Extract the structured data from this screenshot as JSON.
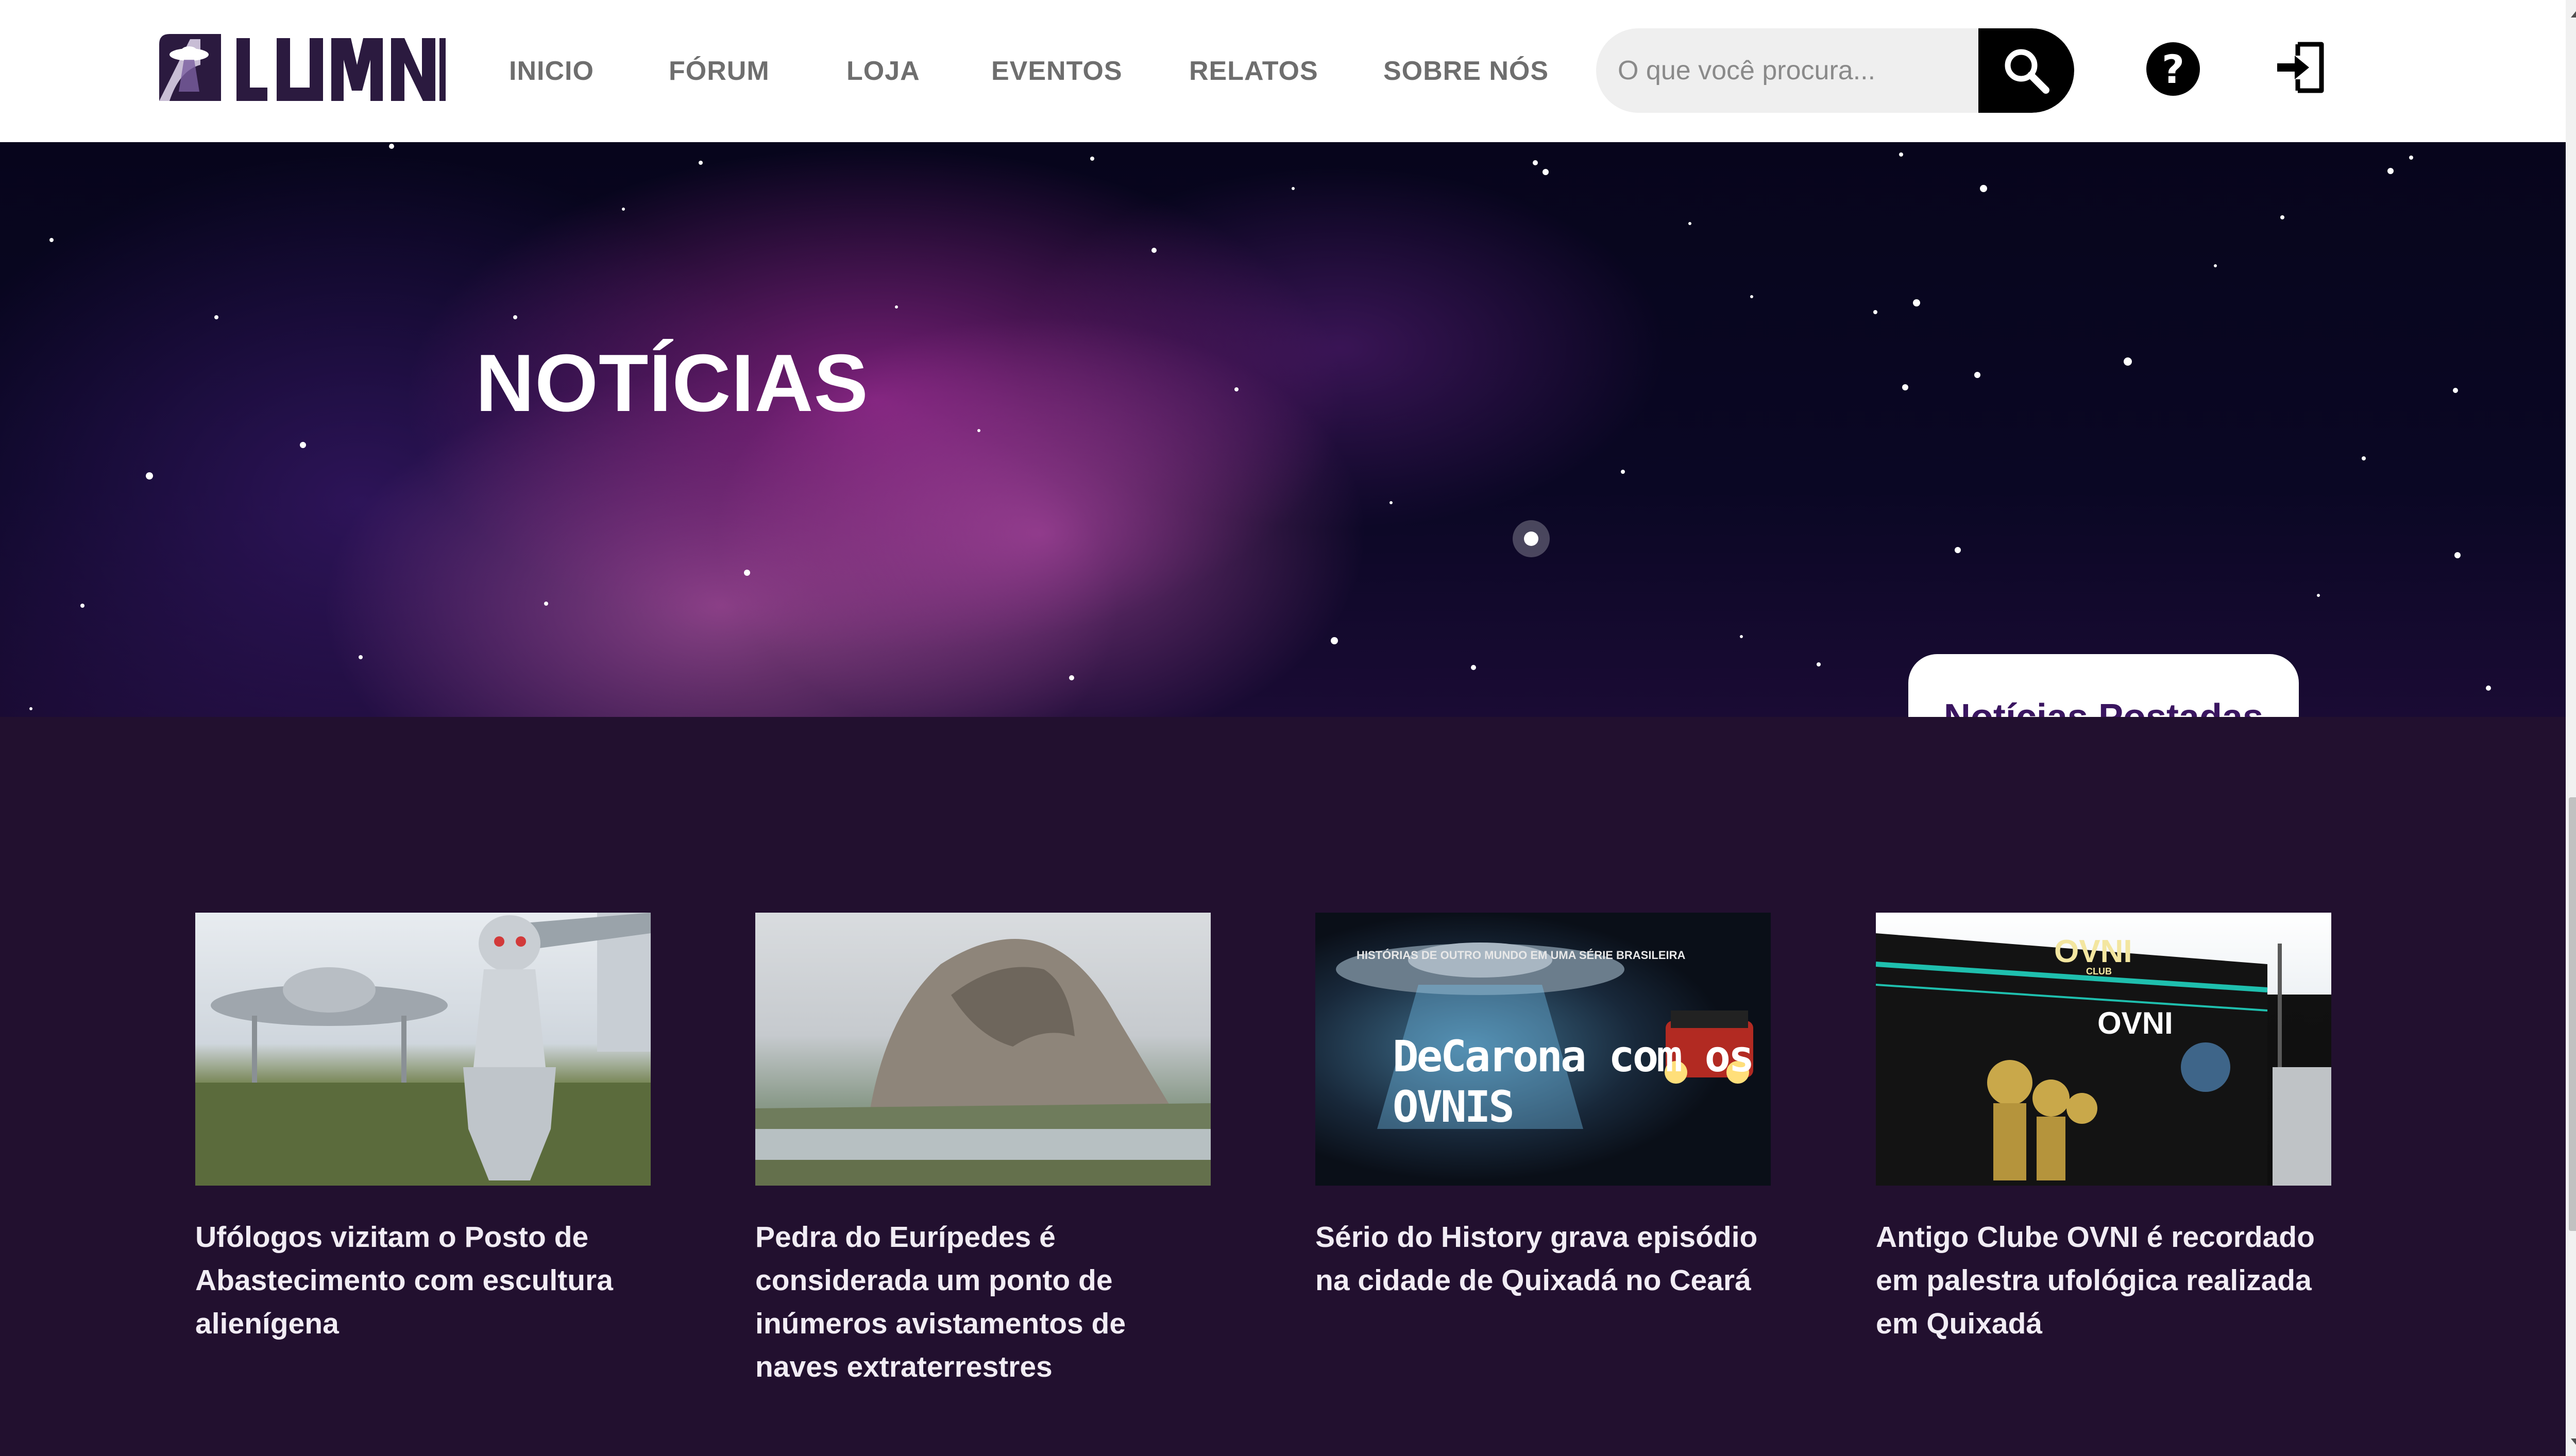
{
  "brand": {
    "name": "LUMNI"
  },
  "nav": {
    "items": [
      {
        "label": "INICIO"
      },
      {
        "label": "FÓRUM"
      },
      {
        "label": "LOJA"
      },
      {
        "label": "EVENTOS"
      },
      {
        "label": "RELATOS"
      },
      {
        "label": "SOBRE NÓS"
      }
    ]
  },
  "search": {
    "placeholder": "O que você procura...",
    "icon": "search-icon"
  },
  "actions": {
    "help_icon": "question-icon",
    "help_label": "?",
    "login_icon": "sign-in-icon"
  },
  "hero": {
    "title": "NOTÍCIAS",
    "callout": "Notícias Postadas"
  },
  "news": {
    "items": [
      {
        "title": "Ufólogos vizitam o Posto de Abastecimento com escultura alienígena"
      },
      {
        "title": "Pedra do Eurípedes é considerada um ponto de inúmeros avistamentos de naves extraterrestres"
      },
      {
        "title": "Sério do History grava episódio na cidade de Quixadá no Ceará",
        "image_caption_top": "HISTÓRIAS DE OUTRO MUNDO EM UMA SÉRIE BRASILEIRA",
        "image_logo": "DeCarona com os OVNIS"
      },
      {
        "title": "Antigo Clube OVNI é recordado em palestra ufológica realizada em Quixadá",
        "image_sign_top": "OVNI",
        "image_sign_sub": "CLUB",
        "image_sign_wall": "OVNI"
      }
    ]
  },
  "colors": {
    "header_bg": "#ffffff",
    "nav_text": "#6e6e6e",
    "page_bg": "#22102f",
    "callout_text": "#3a1560",
    "search_btn": "#000000"
  }
}
